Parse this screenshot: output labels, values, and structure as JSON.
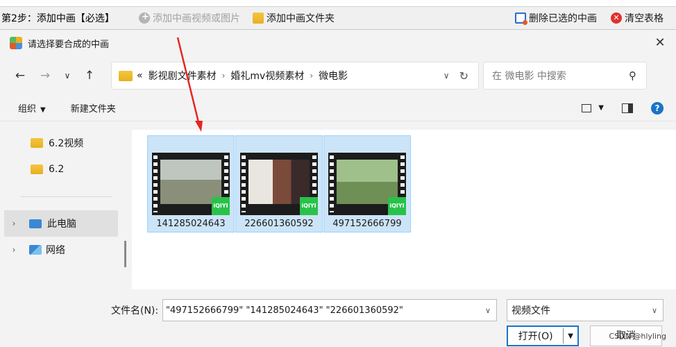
{
  "app": {
    "step_label": "第2步：添加中画【必选】",
    "add_video_label": "添加中画视频或图片",
    "add_folder_label": "添加中画文件夹",
    "delete_selected_label": "删除已选的中画",
    "clear_table_label": "清空表格"
  },
  "dialog": {
    "title": "请选择要合成的中画",
    "close_glyph": "✕",
    "breadcrumb": [
      "影视剧文件素材",
      "婚礼mv视频素材",
      "微电影"
    ],
    "breadcrumb_overflow": "«",
    "search_placeholder": "在 微电影 中搜索",
    "commands": {
      "organize": "组织",
      "new_folder": "新建文件夹"
    },
    "nav": {
      "folders": [
        "6.2视频",
        "6.2"
      ],
      "this_pc": "此电脑",
      "network": "网络"
    },
    "files": [
      {
        "name": "141285024643",
        "badge": "iQIYI"
      },
      {
        "name": "226601360592",
        "badge": "iQIYI"
      },
      {
        "name": "497152666799",
        "badge": "iQIYI"
      }
    ],
    "filename_label": "文件名(N):",
    "filename_value": "\"497152666799\" \"141285024643\" \"226601360592\"",
    "filetype_value": "视频文件",
    "open_label": "打开(O)",
    "cancel_label": "取消",
    "watermark": "CSDN @hlyling"
  },
  "colors": {
    "selection": "#cce4f7",
    "accent": "#1a73c8",
    "arrow": "#e8251f"
  }
}
